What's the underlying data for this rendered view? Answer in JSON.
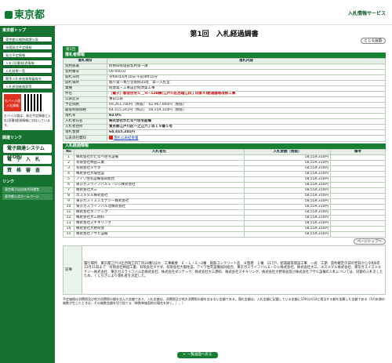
{
  "header": {
    "logo": "東京都",
    "service": "入札情報サービス"
  },
  "sidebar": {
    "head1": "東京都トップ",
    "items": [
      "東京都公報財政課公表",
      "年間発注予定情報",
      "発注予定情報",
      "入札(見積)経過情報",
      "入札結果一覧",
      "競争入札参加資格審査名",
      "入札参加者検索等"
    ],
    "mobile_title": "モバイル版",
    "mobile_sub": "入札情報",
    "mobile_text": "モバイル版は、発注予定情報と入札(見積)経過情報に対応しています。",
    "head2": "関連リンク",
    "btns": [
      "電子調達システム(TOP)",
      "電　子　入　札",
      "資　格　審　査"
    ],
    "head3": "リンク",
    "links": [
      "東京電子自治体共同運営",
      "東京都公式ホームページ"
    ]
  },
  "main": {
    "title": "第1回　入札経過調書",
    "top_tag": "第1回",
    "close_btn": "とじる画面",
    "sec1": "落札者情報",
    "col_item": "落札項目",
    "col_content": "落札内容",
    "rows": [
      [
        "契約部署",
        "財務局経理部契約第一課"
      ],
      [
        "契約番号",
        "06-00031"
      ],
      [
        "開札日時",
        "令和6年6月10日 午前9時15分"
      ],
      [
        "開札場所",
        "都庁第一本庁舎南側35階　第一入札室"
      ],
      [
        "業種",
        "経建築・工事設計経改築工事"
      ],
      [
        "件名",
        "［電子］都営住宅Ｓ＿Ｈ−128棟(江戸川区西瑞江四丁目第４)給湯器等改修工事"
      ],
      [
        "公表区分",
        "事前公表"
      ],
      [
        "予定価格",
        "69,263,700円（税抜）　62,967,000円（税抜）"
      ],
      [
        "最低制限価格",
        "64,415,241円（税込）　58,559,310円（税抜）"
      ],
      [
        "落札率",
        "93.0%"
      ],
      [
        "入札者氏名",
        "株式会社わたなべ住宅設備"
      ],
      [
        "入札者住所",
        "東京都江戸川区一之江六丁目１９番５号"
      ],
      [
        "落札金額",
        "64,415,241円"
      ],
      [
        "公表添付資料",
        "落札公表結果書"
      ]
    ],
    "sec2": "入札経過情報",
    "col_no": "No",
    "col_name": "入札者名",
    "col_amount": "入札金額（税抜）",
    "col_remark": "備考",
    "bidders": [
      [
        "1",
        "株式会社わたなべ住宅設備",
        "58,559,310円"
      ],
      [
        "2",
        "有限会社林田工業",
        "58,559,310円"
      ],
      [
        "3",
        "有限会社タケダ",
        "58,559,310円"
      ],
      [
        "4",
        "株式会社大陽住設",
        "58,559,310円"
      ],
      [
        "5",
        "アイワ住宅設備協同組合",
        "58,559,310円"
      ],
      [
        "6",
        "東京ガスライフバルＥ−Ｄｏ株式会社",
        "58,559,310円"
      ],
      [
        "7",
        "株式会社大三",
        "58,559,310円"
      ],
      [
        "8",
        "エスメタル株式会社",
        "58,559,310円"
      ],
      [
        "9",
        "東京ガスイズミエナジー株式会社",
        "58,559,310円"
      ],
      [
        "10",
        "東京ガスライフバル北株式会社",
        "58,559,310円"
      ],
      [
        "11",
        "株式会社ダンテック",
        "58,559,310円"
      ],
      [
        "12",
        "株式会社大三燃料",
        "58,559,310円"
      ],
      [
        "13",
        "株式会社スギキリング",
        "58,559,310円"
      ],
      [
        "14",
        "株式会社大野商会",
        "58,559,310円"
      ],
      [
        "15",
        "株式会社アサヒ設備",
        "58,559,310円"
      ]
    ],
    "more_btn": "ページトップへ",
    "rmk_label": "記事",
    "rmk_text": "履行場所　東京都江戸川区西瑞江四丁目24番5ほか　工事概要　Ｅ・１・Ｅ−2棟　鉄筋コンクリート造　９階建　１棟　117戸、給湯器等増設工事　一式　工期　契約確定の日の翌日から令和6年12月11日まで　有限会社林田工業、有限会社タケダ、有限会社大陽住設、アイワ住宅設備協同組合、東京ガスライフバルＥ−Ｄｏ株式会社、株式会社大三、エスメタル株式会社、東京ガスイズミエナジー株式会社、東京ガスライフバル北株式会社、株式会社ダンテック、株式会社大三燃料、株式会社スギキリング、株式会社大野商会及び株式会社アサヒ設備の入札については、同額の入札をしたため、くじ引きにより落札者を決定した。",
    "note": "予定価格は消費税及び地方消費税の額を含んだ金額であり、入札金額は、消費税及び地方消費税の額を含まない金額である。落札金額は、入札金額に記載している金額に100分の10に相当する額を加算した金額である（1円未満の端数が生じたときは、その端数金額を切り捨てる（単数単価契約の場合を除く。）。）",
    "back": "← 一覧画面へ戻る"
  }
}
